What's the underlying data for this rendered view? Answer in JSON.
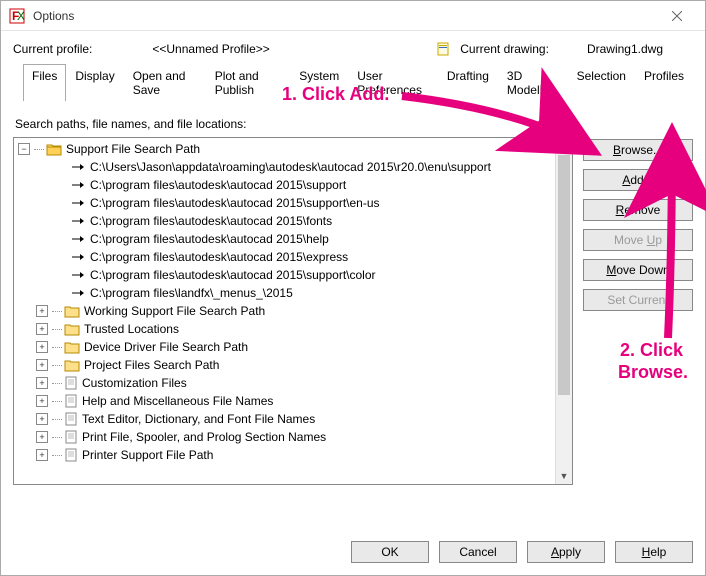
{
  "window": {
    "title": "Options"
  },
  "profile": {
    "label": "Current profile:",
    "value": "<<Unnamed Profile>>",
    "drawing_label": "Current drawing:",
    "drawing_value": "Drawing1.dwg"
  },
  "tabs": [
    "Files",
    "Display",
    "Open and Save",
    "Plot and Publish",
    "System",
    "User Preferences",
    "Drafting",
    "3D Modeling",
    "Selection",
    "Profiles"
  ],
  "active_tab": 0,
  "search_label": "Search paths, file names, and file locations:",
  "tree": {
    "root": "Support File Search Path",
    "paths": [
      "C:\\Users\\Jason\\appdata\\roaming\\autodesk\\autocad 2015\\r20.0\\enu\\support",
      "C:\\program files\\autodesk\\autocad 2015\\support",
      "C:\\program files\\autodesk\\autocad 2015\\support\\en-us",
      "C:\\program files\\autodesk\\autocad 2015\\fonts",
      "C:\\program files\\autodesk\\autocad 2015\\help",
      "C:\\program files\\autodesk\\autocad 2015\\express",
      "C:\\program files\\autodesk\\autocad 2015\\support\\color",
      "C:\\program files\\landfx\\_menus_\\2015"
    ],
    "siblings": [
      "Working Support File Search Path",
      "Trusted Locations",
      "Device Driver File Search Path",
      "Project Files Search Path",
      "Customization Files",
      "Help and Miscellaneous File Names",
      "Text Editor, Dictionary, and Font File Names",
      "Print File, Spooler, and Prolog Section Names",
      "Printer Support File Path"
    ]
  },
  "side_buttons": {
    "browse": "Browse...",
    "add": "Add...",
    "remove": "Remove",
    "move_up": "Move Up",
    "move_down": "Move Down",
    "set_current": "Set Current"
  },
  "bottom_buttons": {
    "ok": "OK",
    "cancel": "Cancel",
    "apply": "Apply",
    "help": "Help"
  },
  "annotations": {
    "step1": "1. Click Add.",
    "step2a": "2. Click",
    "step2b": "Browse."
  }
}
